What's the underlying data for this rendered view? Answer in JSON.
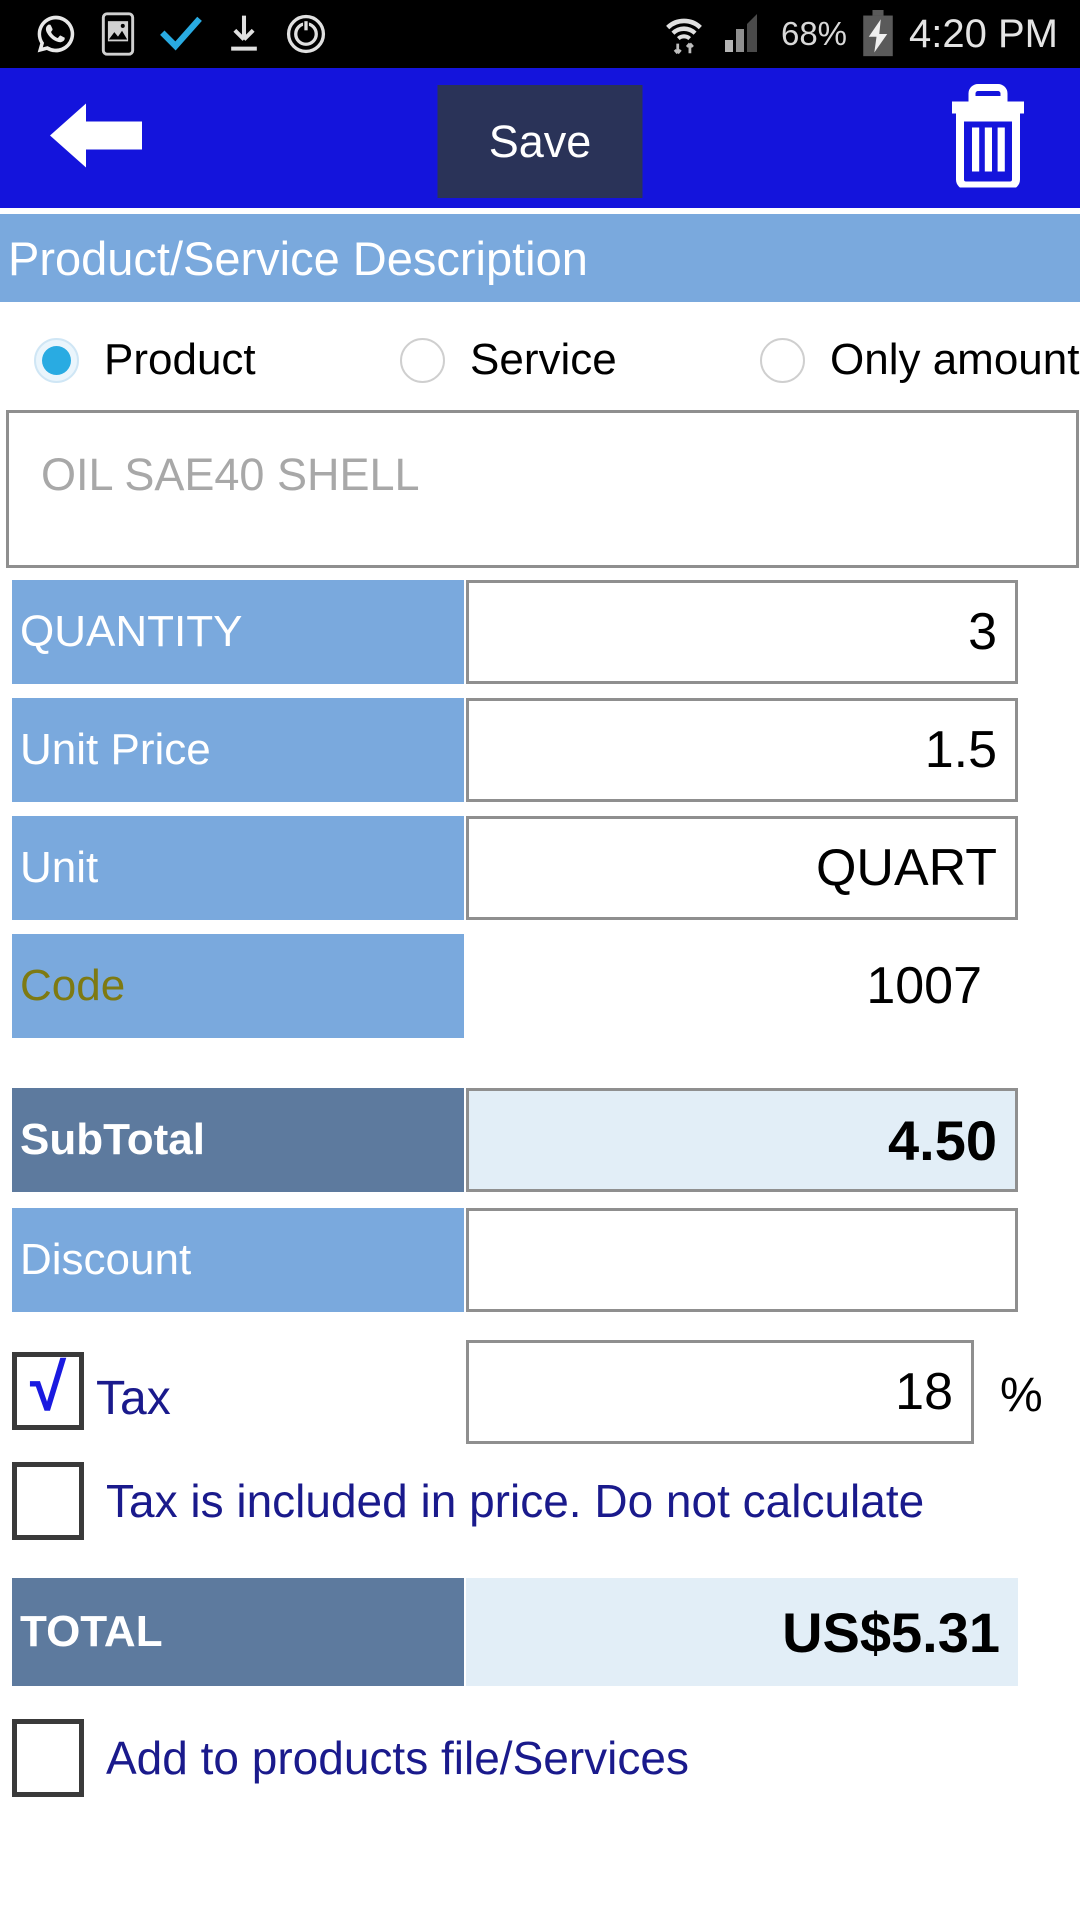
{
  "statusbar": {
    "icons": [
      "whatsapp-icon",
      "screenshot-icon",
      "check-icon",
      "download-icon",
      "power-sync-icon"
    ],
    "wifi_icon": "wifi-icon",
    "signal_icon": "signal-icon",
    "battery_percent": "68%",
    "battery_icon": "battery-charging-icon",
    "time": "4:20 PM"
  },
  "toolbar": {
    "back_icon": "back-arrow-icon",
    "save_label": "Save",
    "delete_icon": "trash-icon",
    "bg_color": "#1414dc",
    "save_bg_color": "#2a3358"
  },
  "section": {
    "title": "Product/Service Description",
    "bg_color": "#7aa9dd"
  },
  "type_selector": {
    "selected": "Product",
    "options": [
      {
        "label": "Product",
        "checked": true
      },
      {
        "label": "Service",
        "checked": false
      },
      {
        "label": "Only amount",
        "checked": false
      }
    ]
  },
  "description": {
    "value": "",
    "placeholder": "OIL SAE40 SHELL"
  },
  "fields": [
    {
      "label": "QUANTITY",
      "value": "3",
      "boxed": true,
      "style": "light"
    },
    {
      "label": "Unit Price",
      "value": "1.5",
      "boxed": true,
      "style": "light"
    },
    {
      "label": "Unit",
      "value": "QUART",
      "boxed": true,
      "style": "light"
    },
    {
      "label": "Code",
      "value": "1007",
      "boxed": false,
      "style": "code"
    }
  ],
  "subtotal": {
    "label": "SubTotal",
    "value": "4.50"
  },
  "discount": {
    "label": "Discount",
    "value": ""
  },
  "tax": {
    "label": "Tax",
    "checked": true,
    "check_glyph": "√",
    "value": "18",
    "percent_symbol": "%"
  },
  "tax_included": {
    "label": "Tax is included in price. Do not calculate",
    "checked": false
  },
  "total": {
    "label": "TOTAL",
    "value": "US$5.31"
  },
  "add_to_products": {
    "label": "Add to products file/Services",
    "checked": false
  },
  "colors": {
    "toolbar_blue": "#1414dc",
    "label_blue": "#7aa9dd",
    "label_dark_blue": "#5d7a9e",
    "total_field_bg": "#e2eef7",
    "text_navy": "#1a1a8c",
    "code_olive": "#7e7a12"
  }
}
